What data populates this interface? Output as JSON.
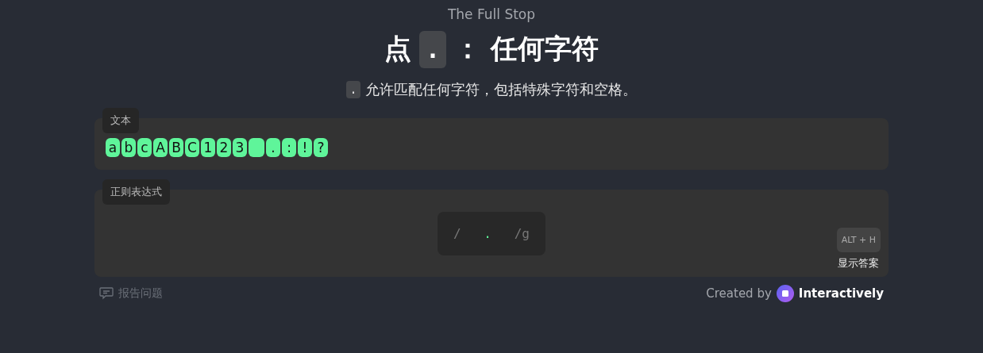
{
  "kicker": "The Full Stop",
  "title": {
    "before": "点",
    "code": ".",
    "after": "： 任何字符"
  },
  "subtitle": {
    "code": ".",
    "text": "允许匹配任何字符，包括特殊字符和空格。"
  },
  "text_panel": {
    "label": "文本",
    "chars": [
      {
        "char": "a",
        "matched": true
      },
      {
        "char": "b",
        "matched": true
      },
      {
        "char": "c",
        "matched": true
      },
      {
        "char": "A",
        "matched": true
      },
      {
        "char": "B",
        "matched": true
      },
      {
        "char": "C",
        "matched": true
      },
      {
        "char": "1",
        "matched": true
      },
      {
        "char": "2",
        "matched": true
      },
      {
        "char": "3",
        "matched": true
      },
      {
        "kind": "space",
        "matched": true
      },
      {
        "char": ".",
        "matched": true
      },
      {
        "char": ":",
        "matched": true
      },
      {
        "char": "!",
        "matched": true
      },
      {
        "char": "?",
        "matched": true
      }
    ]
  },
  "regex_panel": {
    "label": "正则表达式",
    "open": "/",
    "value": ".",
    "flags": "/g",
    "hint_key": "ALT + H",
    "hint_label": "显示答案"
  },
  "footer": {
    "report": "报告问题",
    "created_by": "Created by",
    "brand": "Interactively"
  }
}
